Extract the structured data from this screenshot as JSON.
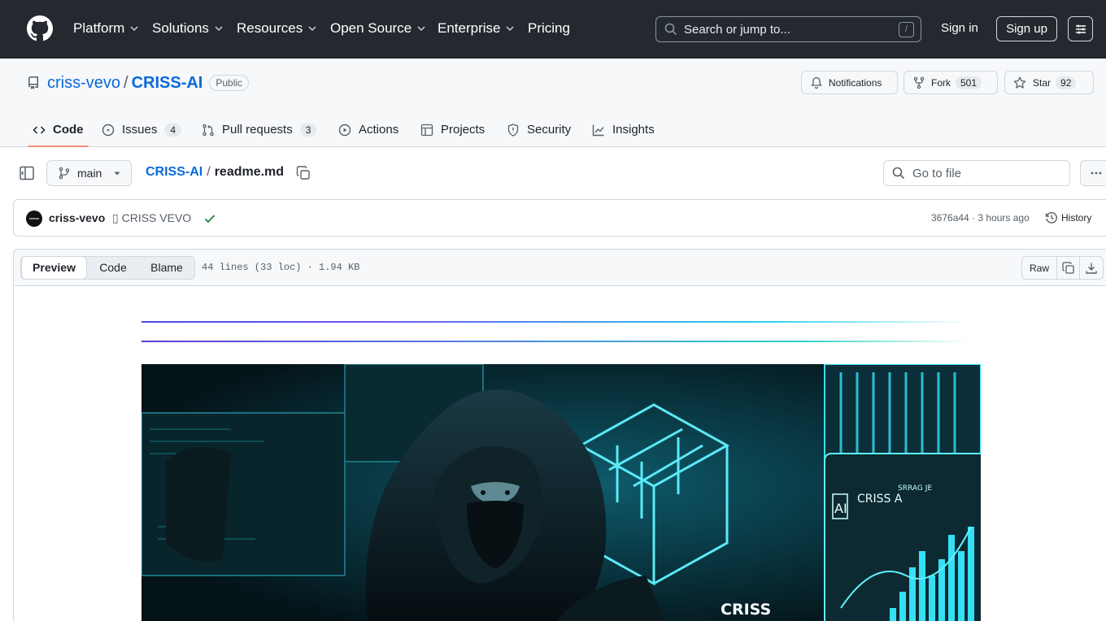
{
  "header": {
    "nav": [
      {
        "label": "Platform",
        "has_dropdown": true
      },
      {
        "label": "Solutions",
        "has_dropdown": true
      },
      {
        "label": "Resources",
        "has_dropdown": true
      },
      {
        "label": "Open Source",
        "has_dropdown": true
      },
      {
        "label": "Enterprise",
        "has_dropdown": true
      },
      {
        "label": "Pricing",
        "has_dropdown": false
      }
    ],
    "search_placeholder": "Search or jump to...",
    "search_shortcut": "/",
    "signin": "Sign in",
    "signup": "Sign up"
  },
  "repo": {
    "owner": "criss-vevo",
    "separator": "/",
    "name": "CRISS-AI",
    "visibility": "Public",
    "notifications": "Notifications",
    "fork_label": "Fork",
    "fork_count": "501",
    "star_label": "Star",
    "star_count": "92"
  },
  "tabs": [
    {
      "label": "Code",
      "count": null,
      "icon": "code-icon",
      "active": true
    },
    {
      "label": "Issues",
      "count": "4",
      "icon": "issue-icon",
      "active": false
    },
    {
      "label": "Pull requests",
      "count": "3",
      "icon": "pull-request-icon",
      "active": false
    },
    {
      "label": "Actions",
      "count": null,
      "icon": "play-icon",
      "active": false
    },
    {
      "label": "Projects",
      "count": null,
      "icon": "table-icon",
      "active": false
    },
    {
      "label": "Security",
      "count": null,
      "icon": "shield-icon",
      "active": false
    },
    {
      "label": "Insights",
      "count": null,
      "icon": "graph-icon",
      "active": false
    }
  ],
  "filebar": {
    "branch": "main",
    "crumb_repo": "CRISS-AI",
    "crumb_sep": "/",
    "crumb_file": "readme.md",
    "goto_placeholder": "Go to file"
  },
  "commit": {
    "author": "criss-vevo",
    "message": "▯ CRISS VEVO",
    "hash_time": "3676a44 · 3 hours ago",
    "history": "History"
  },
  "file": {
    "views": [
      "Preview",
      "Code",
      "Blame"
    ],
    "active_view": "Preview",
    "stats": "44 lines (33 loc) · 1.94 KB",
    "raw": "Raw"
  },
  "hero_image": {
    "texts": {
      "brand": "CRISS",
      "screen_title": "CRISS A",
      "screen_sub": "SRRAG JE",
      "logo_letters": "AI"
    }
  },
  "colors": {
    "header_bg": "#24292f",
    "link": "#0969da",
    "active_tab_underline": "#fd8c73",
    "success": "#1a7f37",
    "hero_accent": "#22d3ee"
  }
}
